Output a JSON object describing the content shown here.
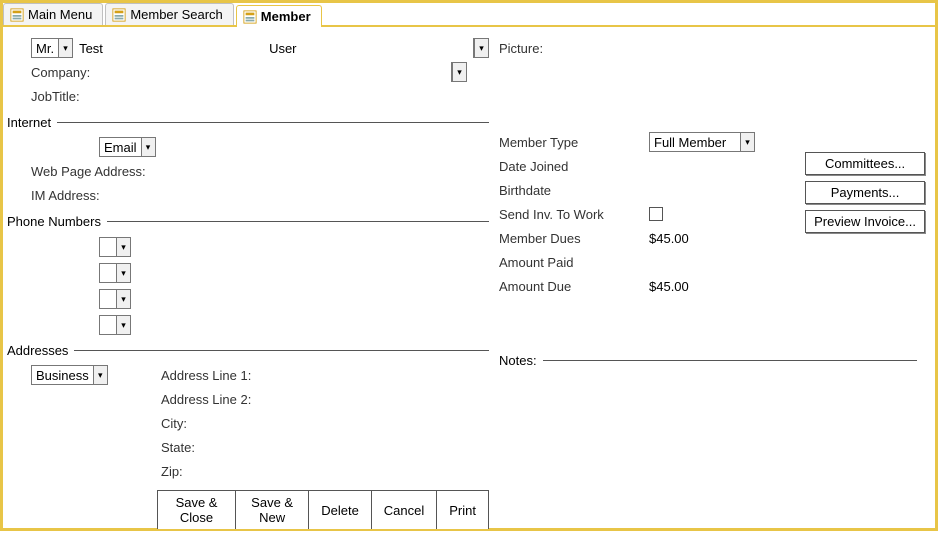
{
  "tabs": [
    {
      "label": "Main Menu",
      "active": false
    },
    {
      "label": "Member Search",
      "active": false
    },
    {
      "label": "Member",
      "active": true
    }
  ],
  "name": {
    "title": "Mr.",
    "first": "Test",
    "last": "User"
  },
  "picture_label": "Picture:",
  "company_label": "Company:",
  "jobtitle_label": "JobTitle:",
  "internet": {
    "section": "Internet",
    "method": "Email",
    "webpage_label": "Web Page Address:",
    "im_label": "IM Address:"
  },
  "member_type": {
    "label": "Member Type",
    "value": "Full Member"
  },
  "date_joined_label": "Date Joined",
  "birthdate_label": "Birthdate",
  "send_inv": {
    "label": "Send Inv. To Work"
  },
  "dues": {
    "label": "Member Dues",
    "value": "$45.00"
  },
  "paid": {
    "label": "Amount Paid"
  },
  "due": {
    "label": "Amount Due",
    "value": "$45.00"
  },
  "buttons": {
    "committees": "Committees...",
    "payments": "Payments...",
    "preview": "Preview Invoice..."
  },
  "phone_section": "Phone Numbers",
  "addresses": {
    "section": "Addresses",
    "type": "Business",
    "line1": "Address Line 1:",
    "line2": "Address Line 2:",
    "city": "City:",
    "state": "State:",
    "zip": "Zip:"
  },
  "notes_section": "Notes:",
  "footer": {
    "save_close": "Save & Close",
    "save_new": "Save & New",
    "delete": "Delete",
    "cancel": "Cancel",
    "print": "Print"
  }
}
